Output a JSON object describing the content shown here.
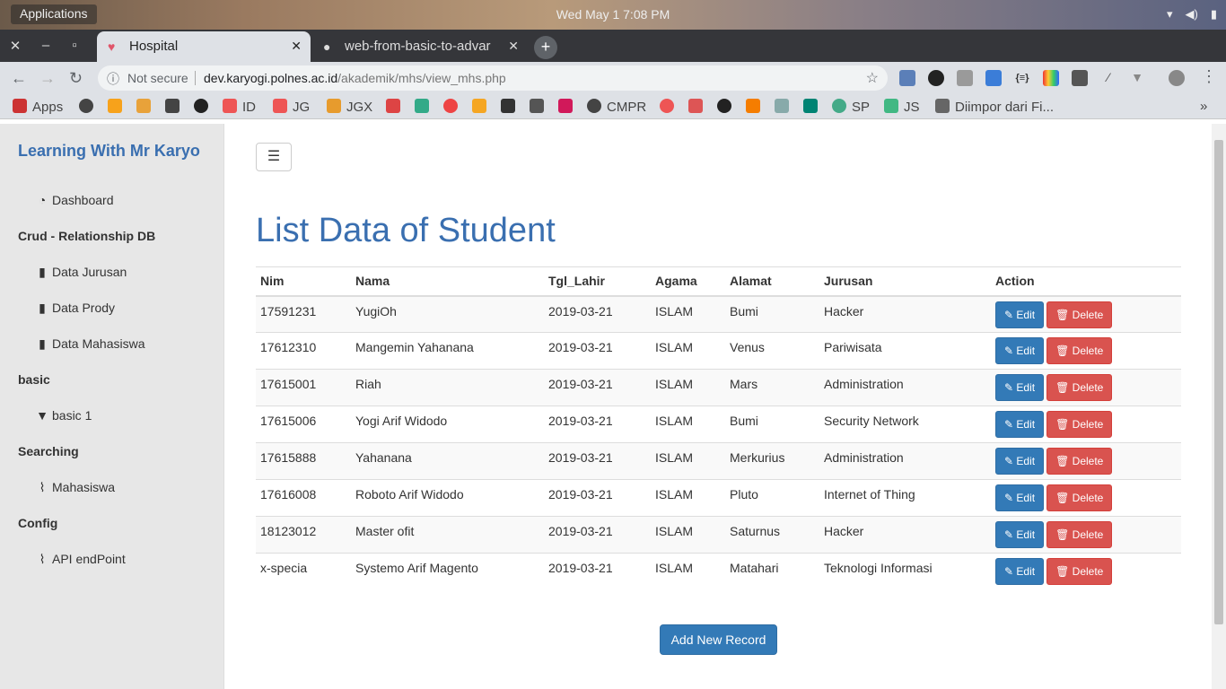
{
  "os": {
    "apps_label": "Applications",
    "clock": "Wed May 1   7:08 PM"
  },
  "browser": {
    "tabs": [
      {
        "label": "Hospital"
      },
      {
        "label": "web-from-basic-to-advar"
      }
    ],
    "omnibox": {
      "security_label": "Not secure",
      "url_host": "dev.karyogi.polnes.ac.id",
      "url_path": "/akademik/mhs/view_mhs.php"
    },
    "bookmarks": [
      "Apps",
      "ID",
      "JG",
      "JGX",
      "CMPR",
      "SP",
      "JS",
      "Diimpor dari Fi..."
    ]
  },
  "sidebar": {
    "brand": "Learning With Mr Karyo",
    "items": [
      {
        "type": "item",
        "label": "Dashboard",
        "icon": "dashboard-icon"
      },
      {
        "type": "head",
        "label": "Crud - Relationship DB"
      },
      {
        "type": "item",
        "label": "Data Jurusan",
        "icon": "book-icon"
      },
      {
        "type": "item",
        "label": "Data Prody",
        "icon": "book-icon"
      },
      {
        "type": "item",
        "label": "Data Mahasiswa",
        "icon": "book-icon"
      },
      {
        "type": "head",
        "label": "basic"
      },
      {
        "type": "item",
        "label": "basic 1",
        "icon": "bookmark-icon"
      },
      {
        "type": "head",
        "label": "Searching"
      },
      {
        "type": "item",
        "label": "Mahasiswa",
        "icon": "paperclip-icon"
      },
      {
        "type": "head",
        "label": "Config"
      },
      {
        "type": "item",
        "label": "API endPoint",
        "icon": "paperclip-icon"
      }
    ]
  },
  "main": {
    "title": "List Data of Student",
    "columns": [
      "Nim",
      "Nama",
      "Tgl_Lahir",
      "Agama",
      "Alamat",
      "Jurusan",
      "Action"
    ],
    "rows": [
      [
        "17591231",
        "YugiOh",
        "2019-03-21",
        "ISLAM",
        "Bumi",
        "Hacker"
      ],
      [
        "17612310",
        "Mangemin Yahanana",
        "2019-03-21",
        "ISLAM",
        "Venus",
        "Pariwisata"
      ],
      [
        "17615001",
        "Riah",
        "2019-03-21",
        "ISLAM",
        "Mars",
        "Administration"
      ],
      [
        "17615006",
        "Yogi Arif Widodo",
        "2019-03-21",
        "ISLAM",
        "Bumi",
        "Security Network"
      ],
      [
        "17615888",
        "Yahanana",
        "2019-03-21",
        "ISLAM",
        "Merkurius",
        "Administration"
      ],
      [
        "17616008",
        "Roboto Arif Widodo",
        "2019-03-21",
        "ISLAM",
        "Pluto",
        "Internet of Thing"
      ],
      [
        "18123012",
        "Master ofit",
        "2019-03-21",
        "ISLAM",
        "Saturnus",
        "Hacker"
      ],
      [
        "x-specia",
        "Systemo Arif Magento",
        "2019-03-21",
        "ISLAM",
        "Matahari",
        "Teknologi Informasi"
      ]
    ],
    "edit_label": "Edit",
    "delete_label": "Delete",
    "add_label": "Add New Record"
  },
  "colors": {
    "primary": "#337ab7",
    "danger": "#d9534f",
    "brand_text": "#3a6fb0"
  }
}
